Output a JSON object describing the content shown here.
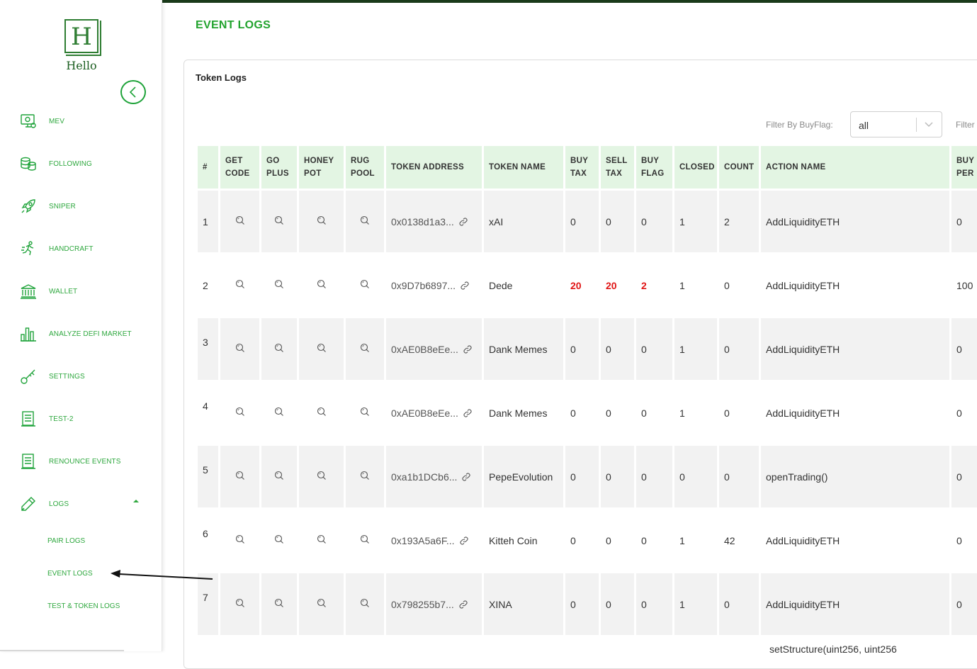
{
  "app": {
    "logo_letter": "H",
    "logo_text": "Hello"
  },
  "sidebar": {
    "items": [
      {
        "label": "MEV",
        "icon": "monitor-coin-icon"
      },
      {
        "label": "FOLLOWING",
        "icon": "coin-stack-icon"
      },
      {
        "label": "SNIPER",
        "icon": "rocket-icon"
      },
      {
        "label": "HANDCRAFT",
        "icon": "running-person-icon"
      },
      {
        "label": "WALLET",
        "icon": "bank-icon"
      },
      {
        "label": "ANALYZE DEFI MARKET",
        "icon": "bar-chart-icon"
      },
      {
        "label": "SETTINGS",
        "icon": "key-icon"
      },
      {
        "label": "TEST-2",
        "icon": "document-icon"
      },
      {
        "label": "RENOUNCE EVENTS",
        "icon": "document-icon"
      },
      {
        "label": "LOGS",
        "icon": "pencil-icon"
      }
    ],
    "logs_sub": [
      "PAIR LOGS",
      "EVENT LOGS",
      "TEST & TOKEN LOGS"
    ]
  },
  "page": {
    "title": "EVENT LOGS",
    "card_title": "Token Logs"
  },
  "filter": {
    "label": "Filter By BuyFlag:",
    "value": "all",
    "label2": "Filter"
  },
  "table": {
    "headers": [
      [
        "#"
      ],
      [
        "GET",
        "CODE"
      ],
      [
        "GO",
        "PLUS"
      ],
      [
        "HONEY",
        "POT"
      ],
      [
        "RUG",
        "POOL"
      ],
      [
        "TOKEN ADDRESS"
      ],
      [
        "TOKEN NAME"
      ],
      [
        "BUY",
        "TAX"
      ],
      [
        "SELL",
        "TAX"
      ],
      [
        "BUY",
        "FLAG"
      ],
      [
        "CLOSED"
      ],
      [
        "COUNT"
      ],
      [
        "ACTION NAME"
      ],
      [
        "BUY",
        "PER"
      ]
    ],
    "rows": [
      {
        "num": "1",
        "address": "0x0138d1a3...",
        "name": "xAI",
        "buy_tax": "0",
        "sell_tax": "0",
        "buy_flag": "0",
        "closed": "1",
        "count": "2",
        "action": "AddLiquidityETH",
        "buy_per": "0",
        "red": false
      },
      {
        "num": "2",
        "address": "0x9D7b6897...",
        "name": "Dede",
        "buy_tax": "20",
        "sell_tax": "20",
        "buy_flag": "2",
        "closed": "1",
        "count": "0",
        "action": "AddLiquidityETH",
        "buy_per": "100",
        "red": true
      },
      {
        "num": "3",
        "address": "0xAE0B8eEe...",
        "name": "Dank Memes",
        "buy_tax": "0",
        "sell_tax": "0",
        "buy_flag": "0",
        "closed": "1",
        "count": "0",
        "action": "AddLiquidityETH",
        "buy_per": "0",
        "red": false
      },
      {
        "num": "4",
        "address": "0xAE0B8eEe...",
        "name": "Dank Memes",
        "buy_tax": "0",
        "sell_tax": "0",
        "buy_flag": "0",
        "closed": "1",
        "count": "0",
        "action": "AddLiquidityETH",
        "buy_per": "0",
        "red": false
      },
      {
        "num": "5",
        "address": "0xa1b1DCb6...",
        "name": "PepeEvolution",
        "buy_tax": "0",
        "sell_tax": "0",
        "buy_flag": "0",
        "closed": "0",
        "count": "0",
        "action": "openTrading()",
        "buy_per": "0",
        "red": false
      },
      {
        "num": "6",
        "address": "0x193A5a6F...",
        "name": "Kitteh Coin",
        "buy_tax": "0",
        "sell_tax": "0",
        "buy_flag": "0",
        "closed": "1",
        "count": "42",
        "action": "AddLiquidityETH",
        "buy_per": "0",
        "red": false
      },
      {
        "num": "7",
        "address": "0x798255b7...",
        "name": "XINA",
        "buy_tax": "0",
        "sell_tax": "0",
        "buy_flag": "0",
        "closed": "1",
        "count": "0",
        "action": "AddLiquidityETH",
        "buy_per": "0",
        "red": false
      }
    ],
    "clipped_action": "setStructure(uint256, uint256"
  },
  "colors": {
    "accent": "#22a32e",
    "header_bg": "#e3f5e3",
    "red": "#e01616"
  }
}
